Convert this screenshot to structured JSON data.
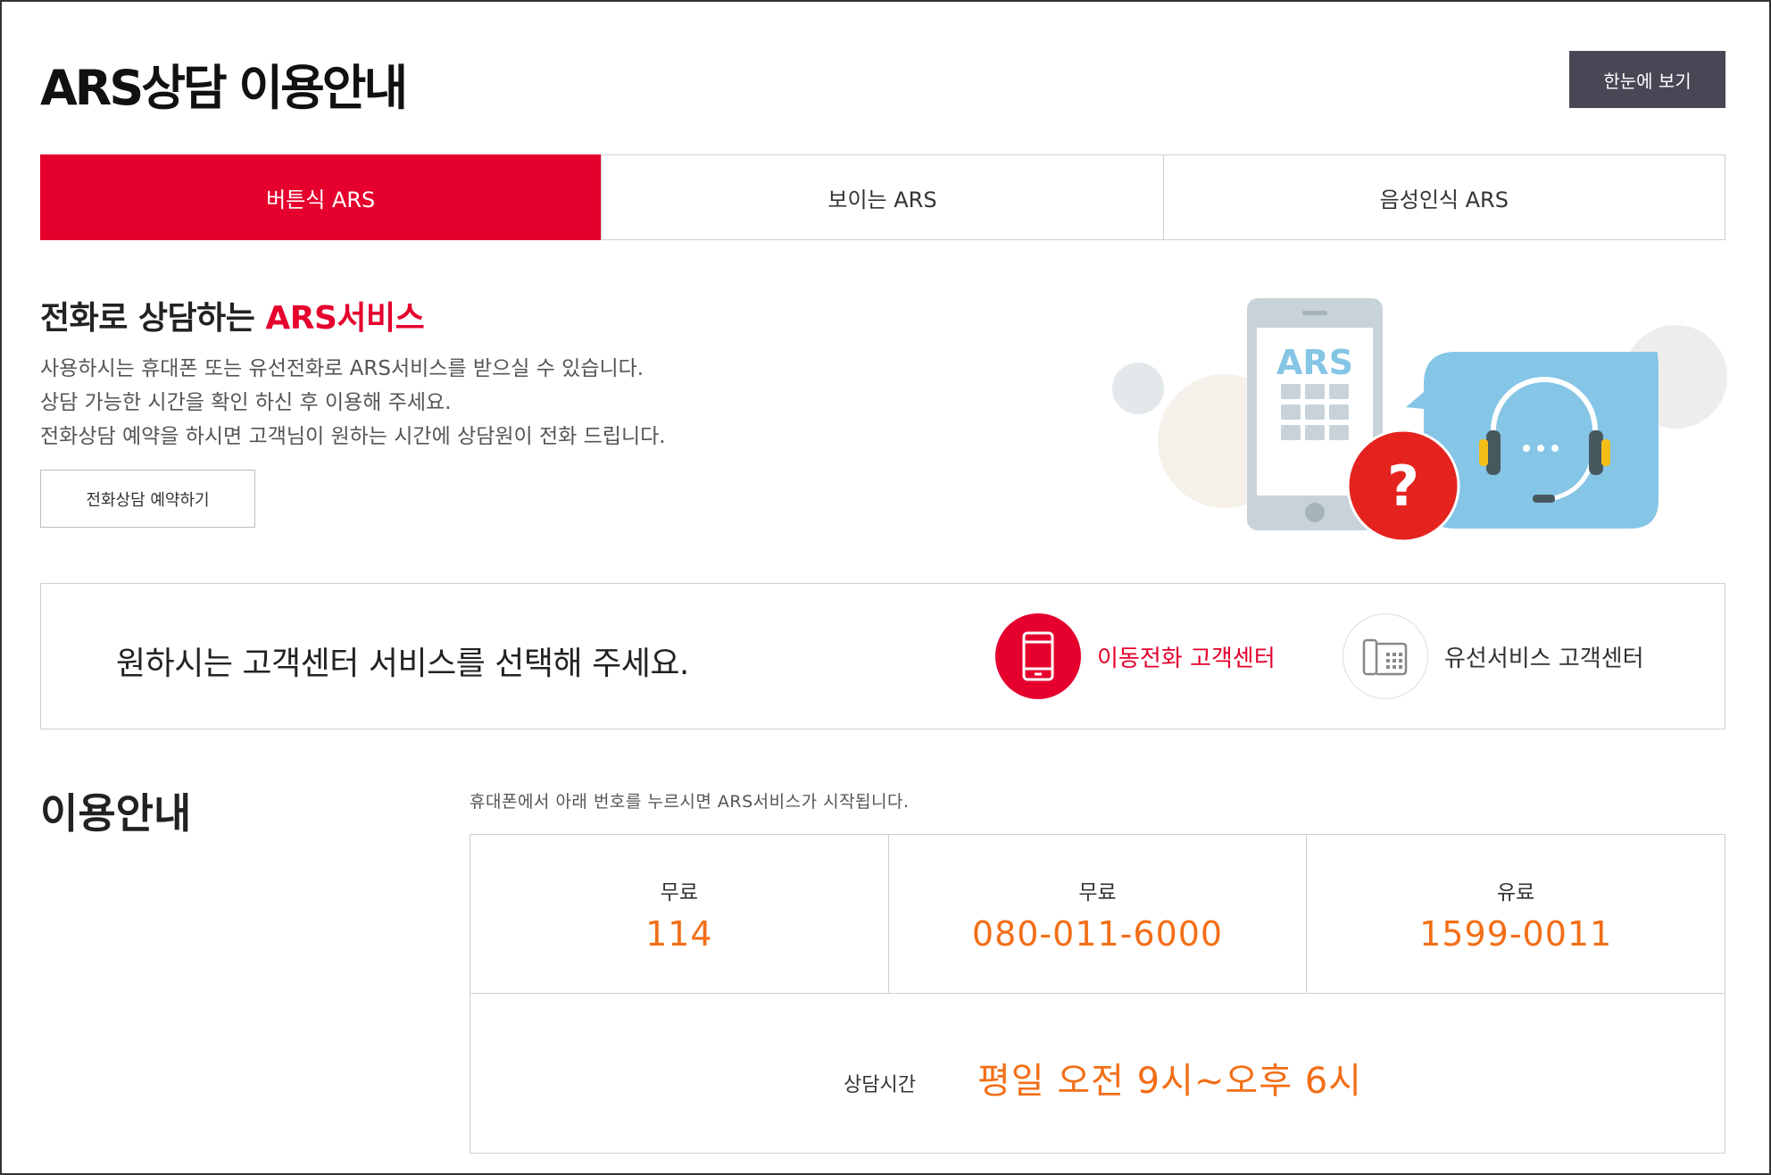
{
  "header": {
    "title": "ARS상담 이용안내",
    "view_all_label": "한눈에 보기"
  },
  "tabs": [
    {
      "label": "버튼식 ARS",
      "active": true
    },
    {
      "label": "보이는 ARS",
      "active": false
    },
    {
      "label": "음성인식 ARS",
      "active": false
    }
  ],
  "intro": {
    "heading_prefix": "전화로 상담하는 ",
    "heading_accent": "ARS서비스",
    "lines": [
      "사용하시는 휴대폰 또는 유선전화로 ARS서비스를 받으실 수 있습니다.",
      "상담 가능한 시간을 확인 하신 후 이용해 주세요.",
      "전화상담 예약을 하시면 고객님이 원하는 시간에 상담원이 전화 드립니다."
    ],
    "reserve_label": "전화상담 예약하기"
  },
  "illustration": {
    "phone_text": "ARS",
    "bubble_text": "?",
    "icons": [
      "smartphone-icon",
      "question-icon",
      "headset-icon",
      "speech-bubble-icon"
    ]
  },
  "service_select": {
    "prompt": "원하시는 고객센터 서비스를 선택해 주세요.",
    "mobile_label": "이동전화 고객센터",
    "wired_label": "유선서비스 고객센터"
  },
  "guide": {
    "title": "이용안내",
    "note": "휴대폰에서 아래 번호를 누르시면 ARS서비스가 시작됩니다.",
    "numbers": [
      {
        "type": "무료",
        "value": "114"
      },
      {
        "type": "무료",
        "value": "080-011-6000"
      },
      {
        "type": "유료",
        "value": "1599-0011"
      }
    ],
    "hours_label": "상담시간",
    "hours_value": "평일 오전 9시~오후 6시"
  },
  "colors": {
    "accent_red": "#e5002d",
    "number_orange": "#f36e17",
    "dark_button": "#484756",
    "bubble_blue": "#85c5e6"
  }
}
